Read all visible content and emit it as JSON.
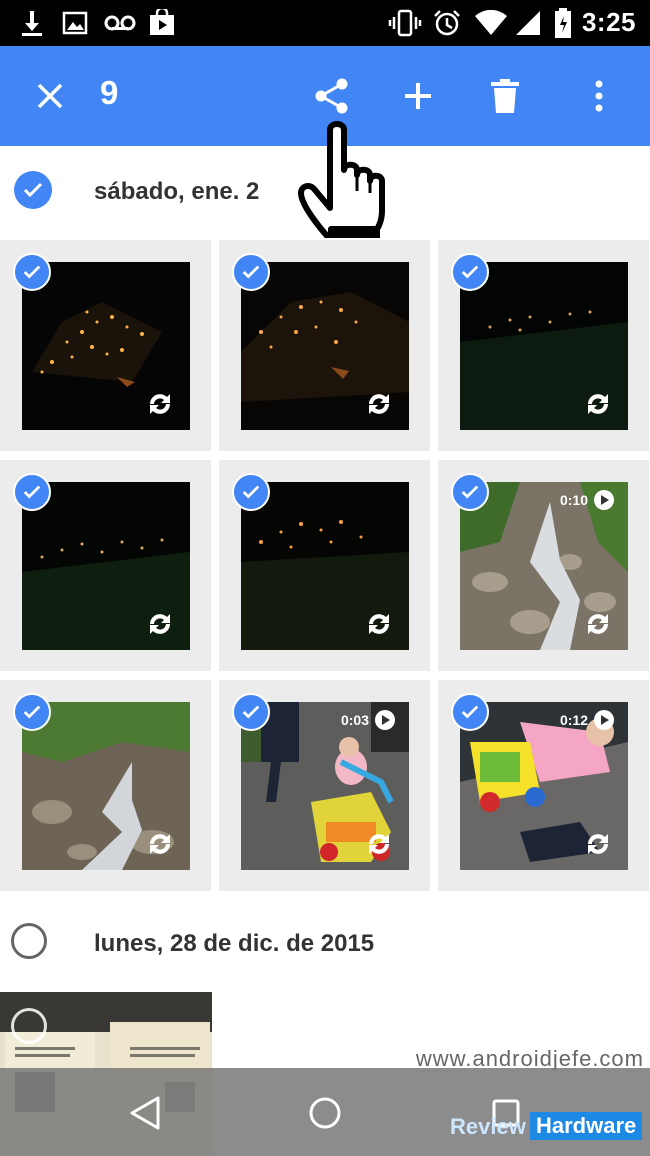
{
  "status_bar": {
    "time": "3:25",
    "icons": [
      "download-icon",
      "image-icon",
      "voicemail-icon",
      "store-icon",
      "vibrate-icon",
      "alarm-icon",
      "wifi-icon",
      "signal-icon",
      "battery-icon"
    ]
  },
  "app_bar": {
    "selected_count": "9",
    "actions": [
      "close",
      "share",
      "add",
      "delete",
      "more"
    ],
    "color": "#4285f4"
  },
  "sections": [
    {
      "title": "sábado, ene. 2",
      "all_selected": true
    },
    {
      "title": "lunes, 28 de dic. de 2015",
      "all_selected": false
    }
  ],
  "photos": [
    {
      "kind": "night",
      "selected": true,
      "video_duration": ""
    },
    {
      "kind": "night",
      "selected": true,
      "video_duration": ""
    },
    {
      "kind": "night",
      "selected": true,
      "video_duration": ""
    },
    {
      "kind": "night",
      "selected": true,
      "video_duration": ""
    },
    {
      "kind": "night",
      "selected": true,
      "video_duration": ""
    },
    {
      "kind": "river",
      "selected": true,
      "video_duration": "0:10"
    },
    {
      "kind": "river",
      "selected": true,
      "video_duration": ""
    },
    {
      "kind": "kid",
      "selected": true,
      "video_duration": "0:03"
    },
    {
      "kind": "kid",
      "selected": true,
      "video_duration": "0:12"
    }
  ],
  "watermark": "www.androidjefe.com",
  "badge": {
    "review": "Review",
    "hardware": "Hardware"
  }
}
